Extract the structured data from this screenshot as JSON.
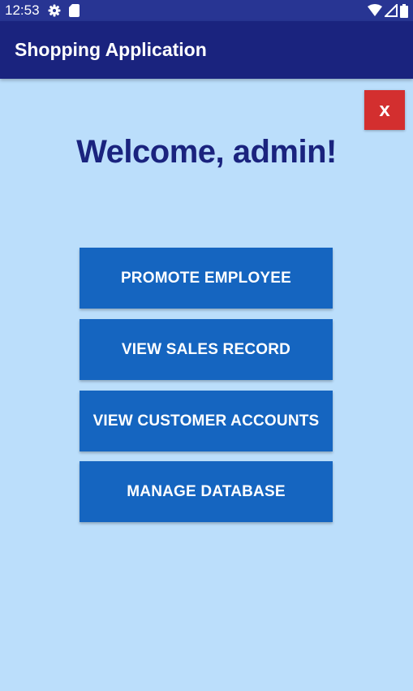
{
  "status_bar": {
    "time": "12:53",
    "left_icons": [
      "gear-icon",
      "sd-card-icon"
    ],
    "right_icons": [
      "wifi-icon",
      "signal-icon",
      "battery-icon"
    ],
    "color": "#283593"
  },
  "app_bar": {
    "title": "Shopping Application",
    "color": "#1a237e"
  },
  "close_button": {
    "label": "x",
    "color": "#d32f2f"
  },
  "welcome": {
    "text": "Welcome, admin!"
  },
  "menu": {
    "items": [
      {
        "label": "PROMOTE EMPLOYEE"
      },
      {
        "label": "VIEW SALES RECORD"
      },
      {
        "label": "VIEW CUSTOMER ACCOUNTS"
      },
      {
        "label": "MANAGE DATABASE"
      }
    ],
    "button_color": "#1565c0"
  },
  "background_color": "#bbdefb"
}
